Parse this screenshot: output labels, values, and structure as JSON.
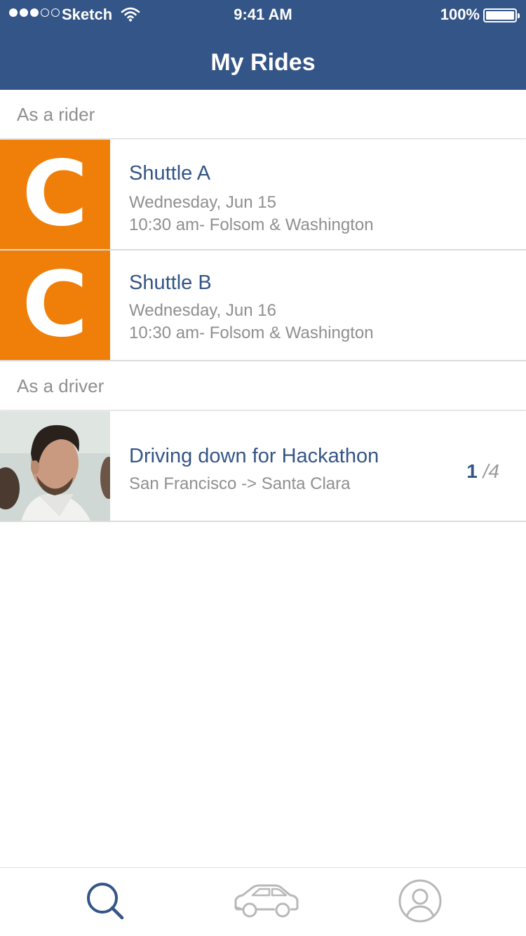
{
  "status_bar": {
    "carrier": "Sketch",
    "time": "9:41 AM",
    "battery": "100%"
  },
  "header": {
    "title": "My Rides"
  },
  "sections": {
    "rider": {
      "label": "As a rider"
    },
    "driver": {
      "label": "As a driver"
    }
  },
  "rider_rides": [
    {
      "logo_letter": "C",
      "title": "Shuttle A",
      "date": "Wednesday, Jun 15",
      "time_location": "10:30 am- Folsom & Washington"
    },
    {
      "logo_letter": "C",
      "title": "Shuttle B",
      "date": "Wednesday, Jun 16",
      "time_location": "10:30 am- Folsom & Washington"
    }
  ],
  "driver_rides": [
    {
      "title": "Driving down for Hackathon",
      "route": "San Francisco -> Santa Clara",
      "seats_taken": "1",
      "seats_total": "/4"
    }
  ],
  "tabbar": {
    "items": [
      {
        "icon": "search-icon",
        "active": true
      },
      {
        "icon": "car-icon",
        "active": false
      },
      {
        "icon": "profile-icon",
        "active": false
      }
    ]
  },
  "colors": {
    "brand": "#345587",
    "accent": "#f07f0a",
    "muted": "#8f8f8f",
    "inactive_icon": "#b8b8b8"
  }
}
